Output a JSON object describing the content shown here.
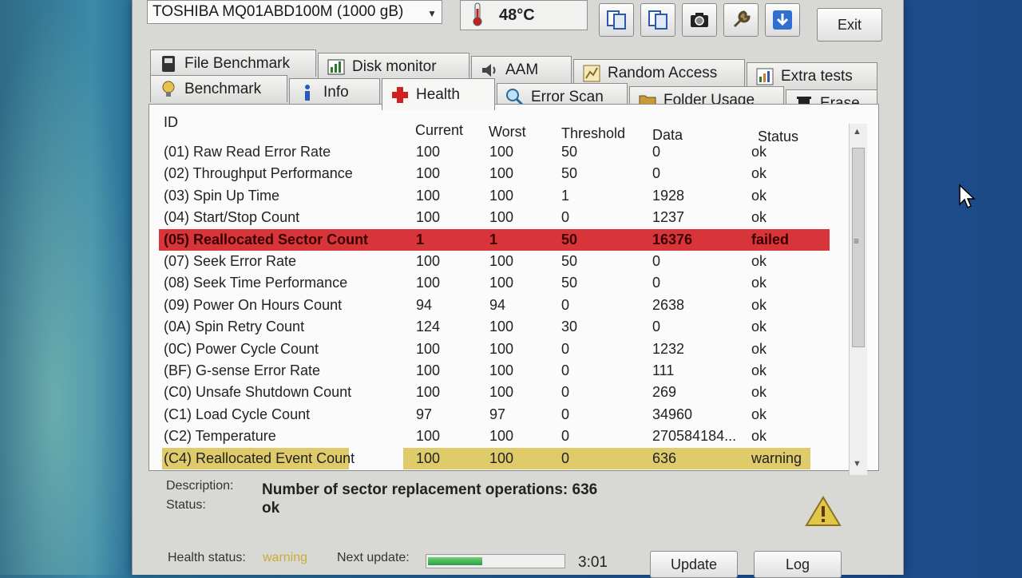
{
  "toolbar": {
    "drive": "TOSHIBA MQ01ABD100M (1000 gB)",
    "temperature": "48°C",
    "exit_label": "Exit"
  },
  "tabs": {
    "row1": [
      "File Benchmark",
      "Disk monitor",
      "AAM",
      "Random Access",
      "Extra tests"
    ],
    "row2": [
      "Benchmark",
      "Info",
      "Health",
      "Error Scan",
      "Folder Usage",
      "Erase"
    ],
    "active": "Health"
  },
  "table": {
    "headers": [
      "ID",
      "Current",
      "Worst",
      "Threshold",
      "Data",
      "Status"
    ],
    "rows": [
      {
        "id": "(01) Raw Read Error Rate",
        "current": "100",
        "worst": "100",
        "threshold": "50",
        "data": "0",
        "status": "ok"
      },
      {
        "id": "(02) Throughput Performance",
        "current": "100",
        "worst": "100",
        "threshold": "50",
        "data": "0",
        "status": "ok"
      },
      {
        "id": "(03) Spin Up Time",
        "current": "100",
        "worst": "100",
        "threshold": "1",
        "data": "1928",
        "status": "ok"
      },
      {
        "id": "(04) Start/Stop Count",
        "current": "100",
        "worst": "100",
        "threshold": "0",
        "data": "1237",
        "status": "ok"
      },
      {
        "id": "(05) Reallocated Sector Count",
        "current": "1",
        "worst": "1",
        "threshold": "50",
        "data": "16376",
        "status": "failed"
      },
      {
        "id": "(07) Seek Error Rate",
        "current": "100",
        "worst": "100",
        "threshold": "50",
        "data": "0",
        "status": "ok"
      },
      {
        "id": "(08) Seek Time Performance",
        "current": "100",
        "worst": "100",
        "threshold": "50",
        "data": "0",
        "status": "ok"
      },
      {
        "id": "(09) Power On Hours Count",
        "current": "94",
        "worst": "94",
        "threshold": "0",
        "data": "2638",
        "status": "ok"
      },
      {
        "id": "(0A) Spin Retry Count",
        "current": "124",
        "worst": "100",
        "threshold": "30",
        "data": "0",
        "status": "ok"
      },
      {
        "id": "(0C) Power Cycle Count",
        "current": "100",
        "worst": "100",
        "threshold": "0",
        "data": "1232",
        "status": "ok"
      },
      {
        "id": "(BF) G-sense Error Rate",
        "current": "100",
        "worst": "100",
        "threshold": "0",
        "data": "111",
        "status": "ok"
      },
      {
        "id": "(C0) Unsafe Shutdown Count",
        "current": "100",
        "worst": "100",
        "threshold": "0",
        "data": "269",
        "status": "ok"
      },
      {
        "id": "(C1) Load Cycle Count",
        "current": "97",
        "worst": "97",
        "threshold": "0",
        "data": "34960",
        "status": "ok"
      },
      {
        "id": "(C2) Temperature",
        "current": "100",
        "worst": "100",
        "threshold": "0",
        "data": "270584184...",
        "status": "ok"
      },
      {
        "id": "(C4) Reallocated Event Count",
        "current": "100",
        "worst": "100",
        "threshold": "0",
        "data": "636",
        "status": "warning"
      }
    ]
  },
  "description": {
    "desc_label": "Description:",
    "desc_value": "Number of sector replacement operations: 636",
    "status_label": "Status:",
    "status_value": "ok"
  },
  "status_bar": {
    "health_label": "Health status:",
    "health_value": "warning",
    "next_update_label": "Next update:",
    "progress": 0.4,
    "countdown": "3:01",
    "update_label": "Update",
    "log_label": "Log"
  },
  "colors": {
    "failed_row": "#d8353a",
    "warning_row": "#e0cb6b",
    "warning_text": "#c9ad3a"
  }
}
